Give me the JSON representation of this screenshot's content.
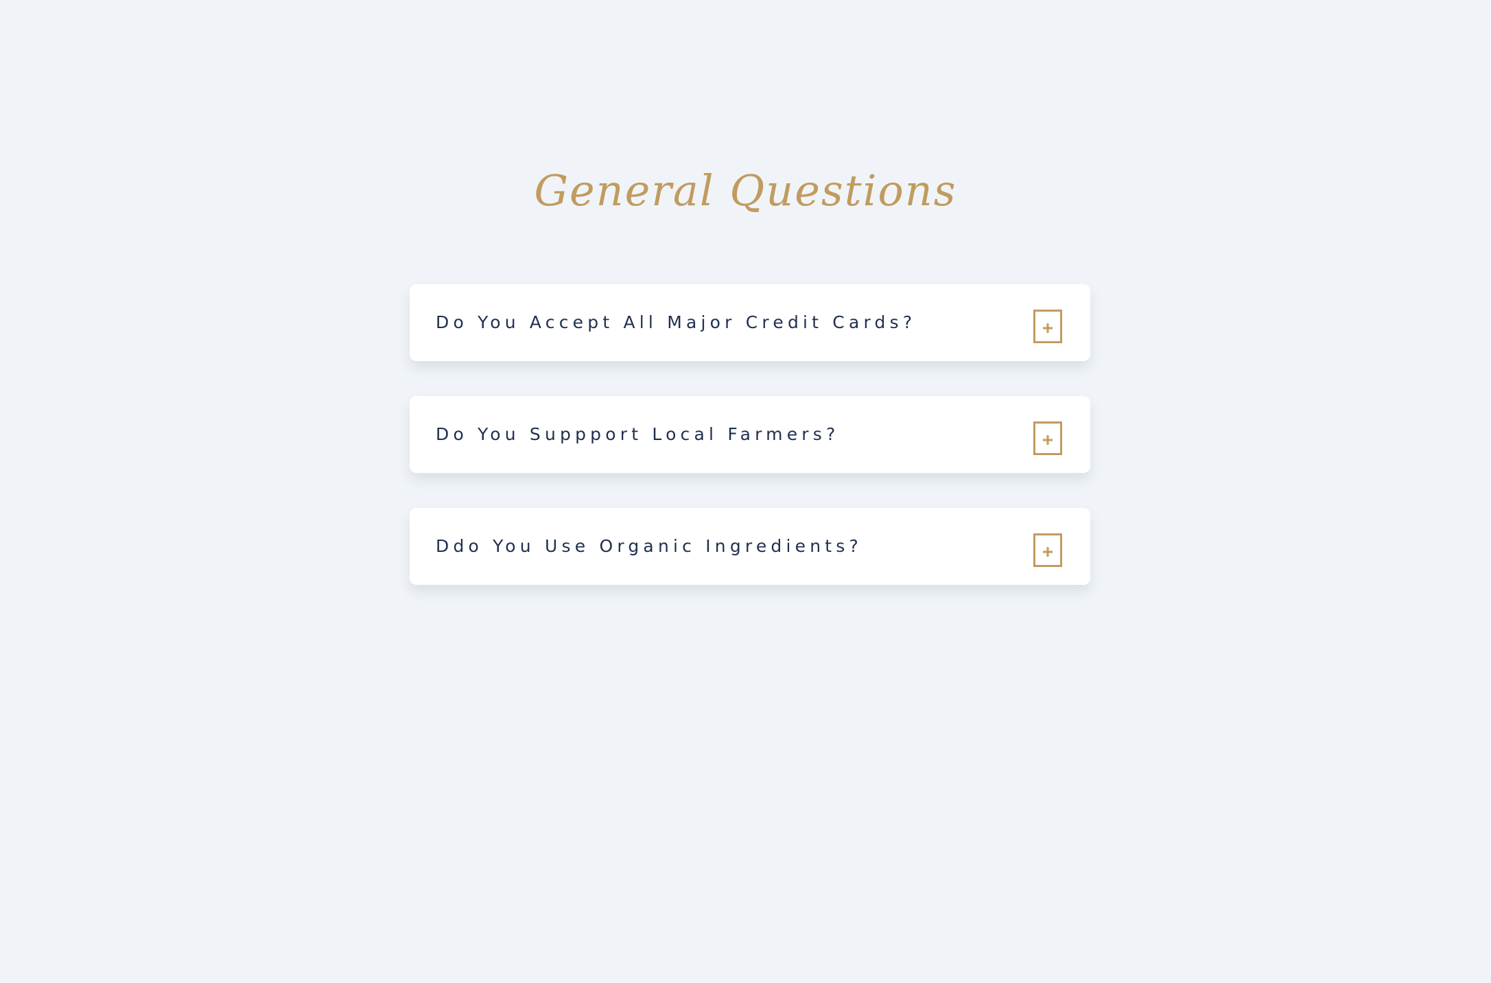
{
  "page": {
    "title": "General Questions"
  },
  "faq": {
    "items": [
      {
        "question": "Do You Accept All Major Credit Cards?",
        "toggle_icon": "plus-icon"
      },
      {
        "question": "Do You Suppport Local Farmers?",
        "toggle_icon": "plus-icon"
      },
      {
        "question": "Ddo You Use Organic Ingredients?",
        "toggle_icon": "plus-icon"
      }
    ]
  },
  "colors": {
    "background": "#f0f4f8",
    "accent": "#c19b5f",
    "question_text": "#1f2f4d",
    "card": "#ffffff"
  }
}
